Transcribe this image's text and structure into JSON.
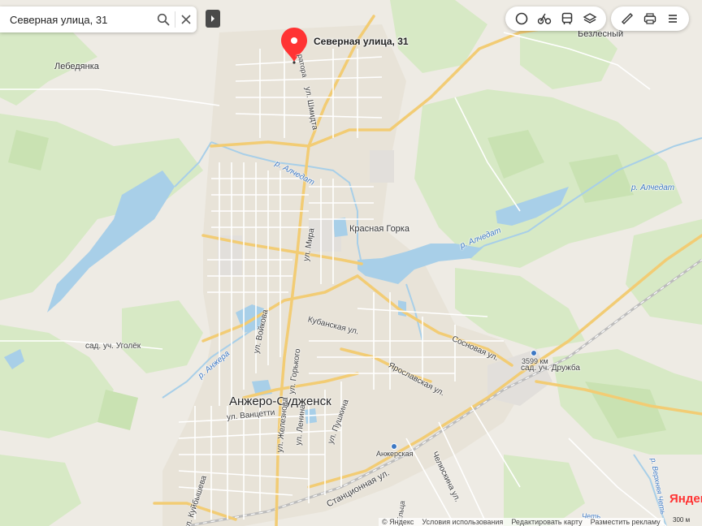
{
  "search": {
    "value": "Северная улица, 31",
    "placeholder": ""
  },
  "toolbar": {
    "buttons": [
      "traffic-icon",
      "cycling-icon",
      "transit-icon",
      "layers-icon"
    ],
    "tools": [
      "ruler-icon",
      "print-icon",
      "menu-icon"
    ]
  },
  "marker": {
    "label": "Северная улица, 31",
    "color": "#ff3333"
  },
  "places": {
    "city": "Анжеро-Судженск",
    "krasnaya_gorka": "Красная Горка",
    "lebedyanka": "Лебедянка",
    "bezlesny": "Безлесный",
    "sad_ugolek": "сад. уч. Уголёк",
    "sad_druzhba": "сад. уч. Дружба",
    "km_3599": "3599 км",
    "anzherskaya": "Анжерская"
  },
  "rivers": {
    "alchedat1": "р. Алчедат",
    "alchedat2": "р. Алчедат",
    "alchedat3": "р. Алчедат",
    "anzhera": "р. Анжера",
    "verkhnyaya": "р. Верхняя Четь",
    "chet": "Четь"
  },
  "streets": {
    "shmidta": "ул. Шмидта",
    "mira": "ул. Мира",
    "voikova": "ул. Войкова",
    "gorkogo": "ул. Горького",
    "kubanskaya": "Кубанская ул.",
    "sosnovaya": "Сосновая ул.",
    "yaroslavskaya": "Ярославская ул.",
    "vanzetti": "ул. Ванцетти",
    "zheleznaya": "ул. Железнова",
    "lenina": "ул. Ленина",
    "pushkina": "ул. Пушкина",
    "kuibysheva": "ул. Куйбышева",
    "stantsionnaya": "Станционная ул.",
    "chelyuskina": "Челюскина ул.",
    "gatora": "ратора",
    "yeletsa": "ул. Ельца"
  },
  "footer": {
    "copyright": "© Яндекс",
    "terms": "Условия использования",
    "edit": "Редактировать карту",
    "ads": "Разместить рекламу",
    "logo": "Яндекс",
    "scale": "300 м"
  },
  "colors": {
    "land": "#eeebe4",
    "forest": "#d4e8c2",
    "water": "#a8cfe8",
    "road_major": "#f5d27a",
    "road_minor": "#ffffff",
    "rail": "#b8b8b8"
  }
}
